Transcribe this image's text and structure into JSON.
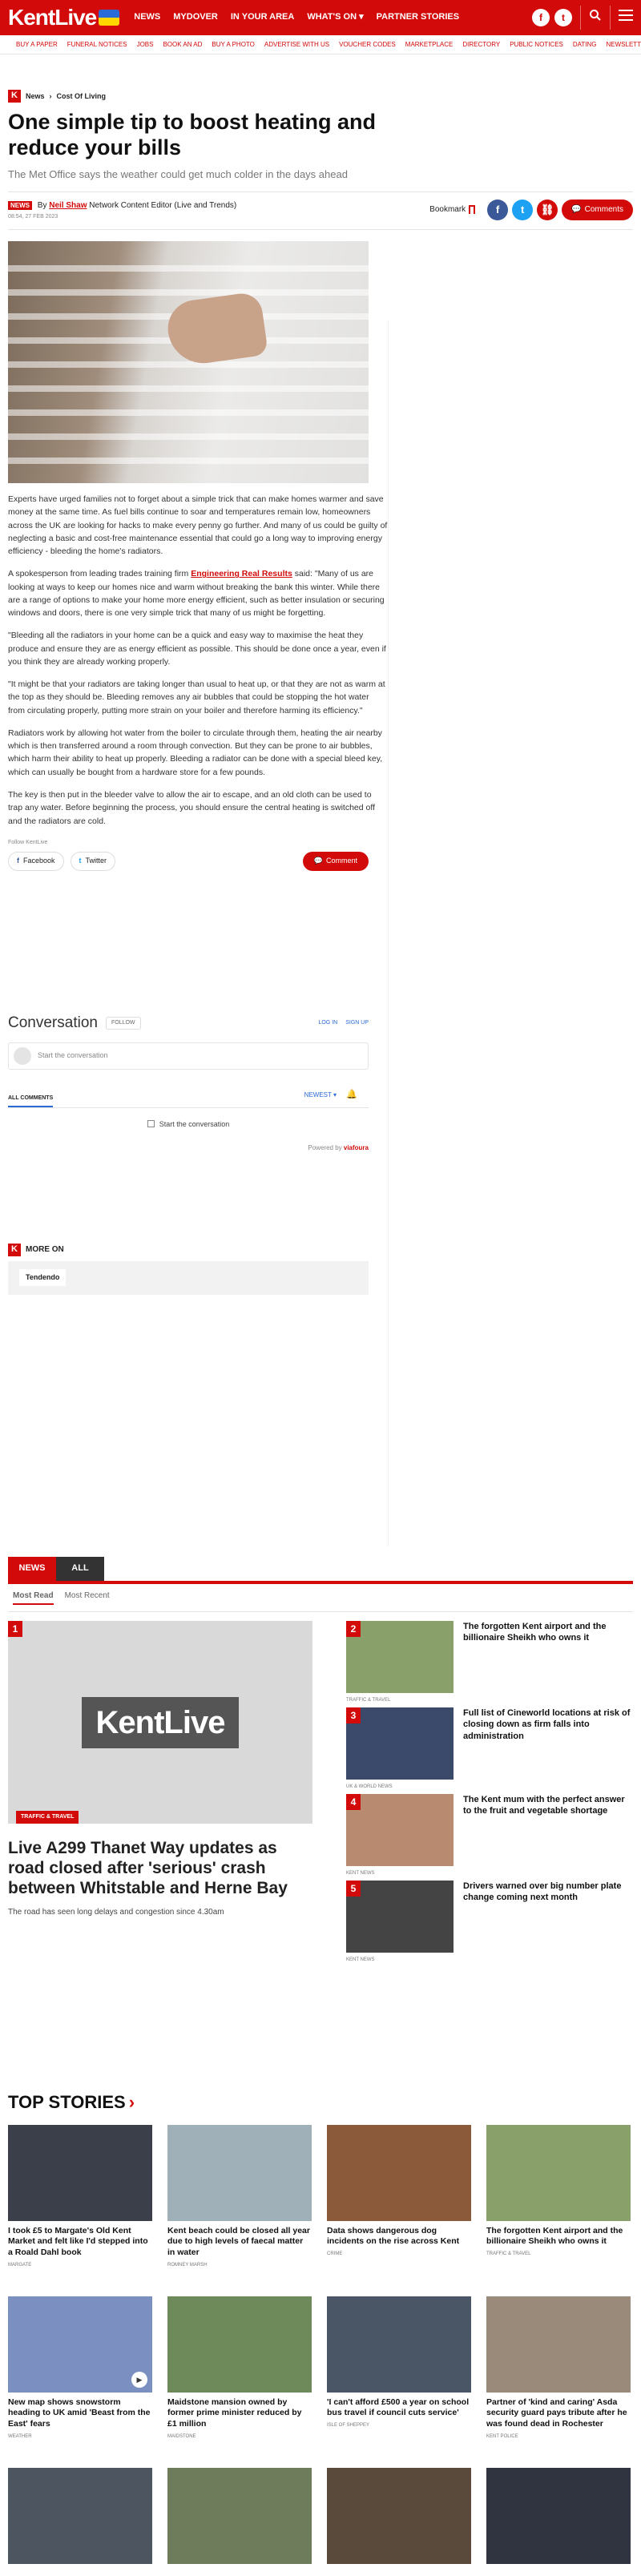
{
  "header": {
    "logo": "KentLive",
    "nav": [
      "NEWS",
      "MYDOVER",
      "IN YOUR AREA",
      "WHAT'S ON ▾",
      "PARTNER STORIES"
    ],
    "subnav": [
      "BUY A PAPER",
      "FUNERAL NOTICES",
      "JOBS",
      "BOOK AN AD",
      "BUY A PHOTO",
      "ADVERTISE WITH US",
      "VOUCHER CODES",
      "MARKETPLACE",
      "DIRECTORY",
      "PUBLIC NOTICES",
      "DATING",
      "NEWSLETTER SIGNUP"
    ]
  },
  "article": {
    "crumbs": [
      "News",
      "Cost Of Living"
    ],
    "title": "One simple tip to boost heating and reduce your bills",
    "standfirst": "The Met Office says the weather could get much colder in the days ahead",
    "badge": "NEWS",
    "by": "By",
    "author": "Neil Shaw",
    "role": "Network Content Editor (Live and Trends)",
    "date": "08:54, 27 FEB 2023",
    "bookmark": "Bookmark",
    "comments": "Comments",
    "p1": "Experts have urged families not to forget about a simple trick that can make homes warmer and save money at the same time. As fuel bills continue to soar and temperatures remain low, homeowners across the UK are looking for hacks to make every penny go further. And many of us could be guilty of neglecting a basic and cost-free maintenance essential that could go a long way to improving energy efficiency - bleeding the home's radiators.",
    "p2_a": "A spokesperson from leading trades training firm ",
    "p2_link": "Engineering Real Results",
    "p2_b": " said: \"Many of us are looking at ways to keep our homes nice and warm without breaking the bank this winter. While there are a range of options to make your home more energy efficient, such as better insulation or securing windows and doors, there is one very simple trick that many of us might be forgetting.",
    "p3": "\"Bleeding all the radiators in your home can be a quick and easy way to maximise the heat they produce and ensure they are as energy efficient as possible. This should be done once a year, even if you think they are already working properly.",
    "p4": "\"It might be that your radiators are taking longer than usual to heat up, or that they are not as warm at the top as they should be. Bleeding removes any air bubbles that could be stopping the hot water from circulating properly, putting more strain on your boiler and therefore harming its efficiency.\"",
    "p5": "Radiators work by allowing hot water from the boiler to circulate through them, heating the air nearby which is then transferred around a room through convection. But they can be prone to air bubbles, which harm their ability to heat up properly. Bleeding a radiator can be done with a special bleed key, which can usually be bought from a hardware store for a few pounds.",
    "p6": "The key is then put in the bleeder valve to allow the air to escape, and an old cloth can be used to trap any water. Before beginning the process, you should ensure the central heating is switched off and the radiators are cold.",
    "follow_label": "Follow KentLive",
    "facebook": "Facebook",
    "twitter": "Twitter",
    "comment": "Comment"
  },
  "conversation": {
    "title": "Conversation",
    "follow": "FOLLOW",
    "login": "LOG IN",
    "signup": "SIGN UP",
    "start_placeholder": "Start the conversation",
    "all_comments": "ALL COMMENTS",
    "sort": "NEWEST ▾",
    "start_btn": "Start the conversation",
    "powered_by": "Powered by",
    "vendor": "viafoura"
  },
  "more_on": {
    "label": "MORE ON",
    "tag": "Tendendo"
  },
  "most_read": {
    "tabs": [
      "NEWS",
      "ALL"
    ],
    "subtabs": [
      "Most Read",
      "Most Recent"
    ],
    "main": {
      "rank": "1",
      "img_text": "KentLive",
      "category": "TRAFFIC & TRAVEL",
      "title": "Live A299 Thanet Way updates as road closed after 'serious' crash between Whitstable and Herne Bay",
      "summary": "The road has seen long delays and congestion since 4.30am"
    },
    "items": [
      {
        "rank": "2",
        "title": "The forgotten Kent airport and the billionaire Sheikh who owns it",
        "category": "TRAFFIC & TRAVEL",
        "color": "#8aa06a"
      },
      {
        "rank": "3",
        "title": "Full list of Cineworld locations at risk of closing down as firm falls into administration",
        "category": "UK & WORLD NEWS",
        "color": "#3b4a6b"
      },
      {
        "rank": "4",
        "title": "The Kent mum with the perfect answer to the fruit and vegetable shortage",
        "category": "KENT NEWS",
        "color": "#b88b70"
      },
      {
        "rank": "5",
        "title": "Drivers warned over big number plate change coming next month",
        "category": "KENT NEWS",
        "color": "#444444"
      }
    ]
  },
  "top_stories": {
    "title": "TOP STORIES",
    "cards": [
      {
        "title": "I took £5 to Margate's Old Kent Market and felt like I'd stepped into a Roald Dahl book",
        "category": "MARGATE",
        "color": "#3a3f4a",
        "video": false
      },
      {
        "title": "Kent beach could be closed all year due to high levels of faecal matter in water",
        "category": "ROMNEY MARSH",
        "color": "#9fb0b8",
        "video": false
      },
      {
        "title": "Data shows dangerous dog incidents on the rise across Kent",
        "category": "CRIME",
        "color": "#8a5a3a",
        "video": false
      },
      {
        "title": "The forgotten Kent airport and the billionaire Sheikh who owns it",
        "category": "TRAFFIC & TRAVEL",
        "color": "#8aa06a",
        "video": false
      },
      {
        "title": "New map shows snowstorm heading to UK amid 'Beast from the East' fears",
        "category": "WEATHER",
        "color": "#7b8fc0",
        "video": true
      },
      {
        "title": "Maidstone mansion owned by former prime minister reduced by £1 million",
        "category": "MAIDSTONE",
        "color": "#6f8a5a",
        "video": false
      },
      {
        "title": "'I can't afford £500 a year on school bus travel if council cuts service'",
        "category": "ISLE OF SHEPPEY",
        "color": "#4a5566",
        "video": false
      },
      {
        "title": "Partner of 'kind and caring' Asda security guard pays tribute after he was found dead in Rochester",
        "category": "KENT POLICE",
        "color": "#9a8a7a",
        "video": false
      },
      {
        "title": "",
        "category": "",
        "color": "#4d5560",
        "video": false
      },
      {
        "title": "",
        "category": "",
        "color": "#6e7c5c",
        "video": false
      },
      {
        "title": "",
        "category": "",
        "color": "#5a4a3c",
        "video": false
      },
      {
        "title": "",
        "category": "",
        "color": "#2f3440",
        "video": false
      }
    ]
  }
}
